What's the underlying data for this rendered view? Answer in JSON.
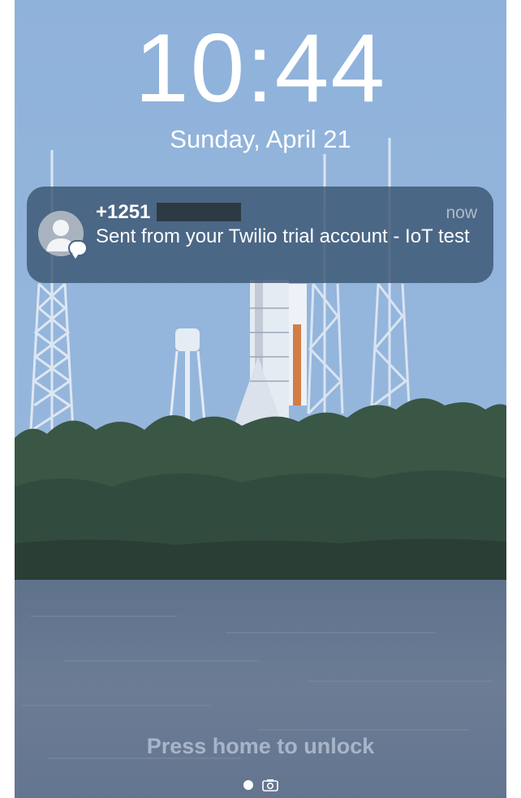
{
  "lockscreen": {
    "time": "10:44",
    "date": "Sunday, April 21"
  },
  "notification": {
    "sender": "+1251",
    "timestamp": "now",
    "message": "Sent from your Twilio trial account - IoT test",
    "icon": "contact-avatar-icon",
    "badge_icon": "message-bubble-icon"
  },
  "footer": {
    "unlock_hint": "Press home to unlock",
    "page_indicator_icon": "page-dot-icon",
    "camera_icon": "camera-icon"
  },
  "colors": {
    "sky": "#8aaed8",
    "notification_bg": "#3c5573",
    "water": "#6e7e96",
    "trees": "#2f4a3c"
  }
}
